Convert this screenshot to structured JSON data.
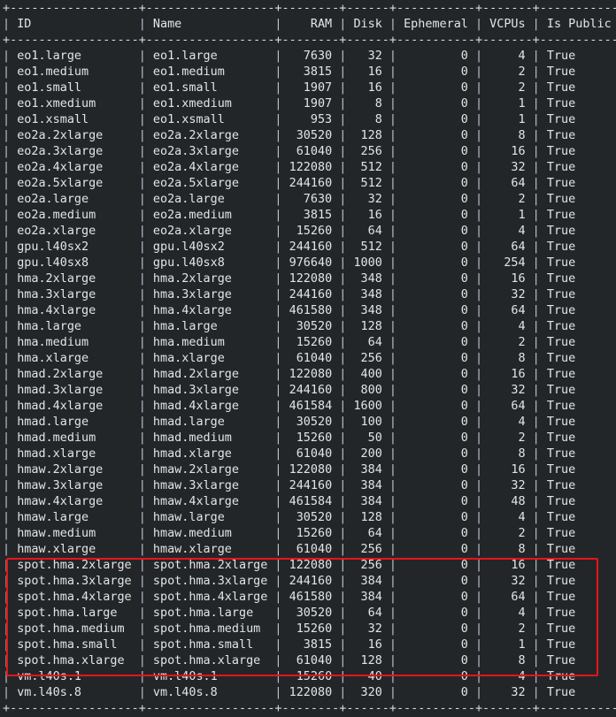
{
  "table": {
    "columns": [
      {
        "label": "ID",
        "width": 16,
        "align": "l"
      },
      {
        "label": "Name",
        "width": 16,
        "align": "l"
      },
      {
        "label": "RAM",
        "width": 6,
        "align": "r"
      },
      {
        "label": "Disk",
        "width": 4,
        "align": "r"
      },
      {
        "label": "Ephemeral",
        "width": 9,
        "align": "r"
      },
      {
        "label": "VCPUs",
        "width": 5,
        "align": "r"
      },
      {
        "label": "Is Public",
        "width": 9,
        "align": "l"
      }
    ],
    "rows": [
      [
        "eo1.large",
        "eo1.large",
        "7630",
        "32",
        "0",
        "4",
        "True"
      ],
      [
        "eo1.medium",
        "eo1.medium",
        "3815",
        "16",
        "0",
        "2",
        "True"
      ],
      [
        "eo1.small",
        "eo1.small",
        "1907",
        "16",
        "0",
        "2",
        "True"
      ],
      [
        "eo1.xmedium",
        "eo1.xmedium",
        "1907",
        "8",
        "0",
        "1",
        "True"
      ],
      [
        "eo1.xsmall",
        "eo1.xsmall",
        "953",
        "8",
        "0",
        "1",
        "True"
      ],
      [
        "eo2a.2xlarge",
        "eo2a.2xlarge",
        "30520",
        "128",
        "0",
        "8",
        "True"
      ],
      [
        "eo2a.3xlarge",
        "eo2a.3xlarge",
        "61040",
        "256",
        "0",
        "16",
        "True"
      ],
      [
        "eo2a.4xlarge",
        "eo2a.4xlarge",
        "122080",
        "512",
        "0",
        "32",
        "True"
      ],
      [
        "eo2a.5xlarge",
        "eo2a.5xlarge",
        "244160",
        "512",
        "0",
        "64",
        "True"
      ],
      [
        "eo2a.large",
        "eo2a.large",
        "7630",
        "32",
        "0",
        "2",
        "True"
      ],
      [
        "eo2a.medium",
        "eo2a.medium",
        "3815",
        "16",
        "0",
        "1",
        "True"
      ],
      [
        "eo2a.xlarge",
        "eo2a.xlarge",
        "15260",
        "64",
        "0",
        "4",
        "True"
      ],
      [
        "gpu.l40sx2",
        "gpu.l40sx2",
        "244160",
        "512",
        "0",
        "64",
        "True"
      ],
      [
        "gpu.l40sx8",
        "gpu.l40sx8",
        "976640",
        "1000",
        "0",
        "254",
        "True"
      ],
      [
        "hma.2xlarge",
        "hma.2xlarge",
        "122080",
        "348",
        "0",
        "16",
        "True"
      ],
      [
        "hma.3xlarge",
        "hma.3xlarge",
        "244160",
        "348",
        "0",
        "32",
        "True"
      ],
      [
        "hma.4xlarge",
        "hma.4xlarge",
        "461580",
        "348",
        "0",
        "64",
        "True"
      ],
      [
        "hma.large",
        "hma.large",
        "30520",
        "128",
        "0",
        "4",
        "True"
      ],
      [
        "hma.medium",
        "hma.medium",
        "15260",
        "64",
        "0",
        "2",
        "True"
      ],
      [
        "hma.xlarge",
        "hma.xlarge",
        "61040",
        "256",
        "0",
        "8",
        "True"
      ],
      [
        "hmad.2xlarge",
        "hmad.2xlarge",
        "122080",
        "400",
        "0",
        "16",
        "True"
      ],
      [
        "hmad.3xlarge",
        "hmad.3xlarge",
        "244160",
        "800",
        "0",
        "32",
        "True"
      ],
      [
        "hmad.4xlarge",
        "hmad.4xlarge",
        "461584",
        "1600",
        "0",
        "64",
        "True"
      ],
      [
        "hmad.large",
        "hmad.large",
        "30520",
        "100",
        "0",
        "4",
        "True"
      ],
      [
        "hmad.medium",
        "hmad.medium",
        "15260",
        "50",
        "0",
        "2",
        "True"
      ],
      [
        "hmad.xlarge",
        "hmad.xlarge",
        "61040",
        "200",
        "0",
        "8",
        "True"
      ],
      [
        "hmaw.2xlarge",
        "hmaw.2xlarge",
        "122080",
        "384",
        "0",
        "16",
        "True"
      ],
      [
        "hmaw.3xlarge",
        "hmaw.3xlarge",
        "244160",
        "384",
        "0",
        "32",
        "True"
      ],
      [
        "hmaw.4xlarge",
        "hmaw.4xlarge",
        "461584",
        "384",
        "0",
        "48",
        "True"
      ],
      [
        "hmaw.large",
        "hmaw.large",
        "30520",
        "128",
        "0",
        "4",
        "True"
      ],
      [
        "hmaw.medium",
        "hmaw.medium",
        "15260",
        "64",
        "0",
        "2",
        "True"
      ],
      [
        "hmaw.xlarge",
        "hmaw.xlarge",
        "61040",
        "256",
        "0",
        "8",
        "True"
      ],
      [
        "spot.hma.2xlarge",
        "spot.hma.2xlarge",
        "122080",
        "256",
        "0",
        "16",
        "True"
      ],
      [
        "spot.hma.3xlarge",
        "spot.hma.3xlarge",
        "244160",
        "384",
        "0",
        "32",
        "True"
      ],
      [
        "spot.hma.4xlarge",
        "spot.hma.4xlarge",
        "461580",
        "384",
        "0",
        "64",
        "True"
      ],
      [
        "spot.hma.large",
        "spot.hma.large",
        "30520",
        "64",
        "0",
        "4",
        "True"
      ],
      [
        "spot.hma.medium",
        "spot.hma.medium",
        "15260",
        "32",
        "0",
        "2",
        "True"
      ],
      [
        "spot.hma.small",
        "spot.hma.small",
        "3815",
        "16",
        "0",
        "1",
        "True"
      ],
      [
        "spot.hma.xlarge",
        "spot.hma.xlarge",
        "61040",
        "128",
        "0",
        "8",
        "True"
      ],
      [
        "vm.l40s.1",
        "vm.l40s.1",
        "15260",
        "40",
        "0",
        "4",
        "True"
      ],
      [
        "vm.l40s.8",
        "vm.l40s.8",
        "122080",
        "320",
        "0",
        "32",
        "True"
      ]
    ]
  },
  "highlight": {
    "color": "#e8141c",
    "rows": "spot.hma.*"
  }
}
